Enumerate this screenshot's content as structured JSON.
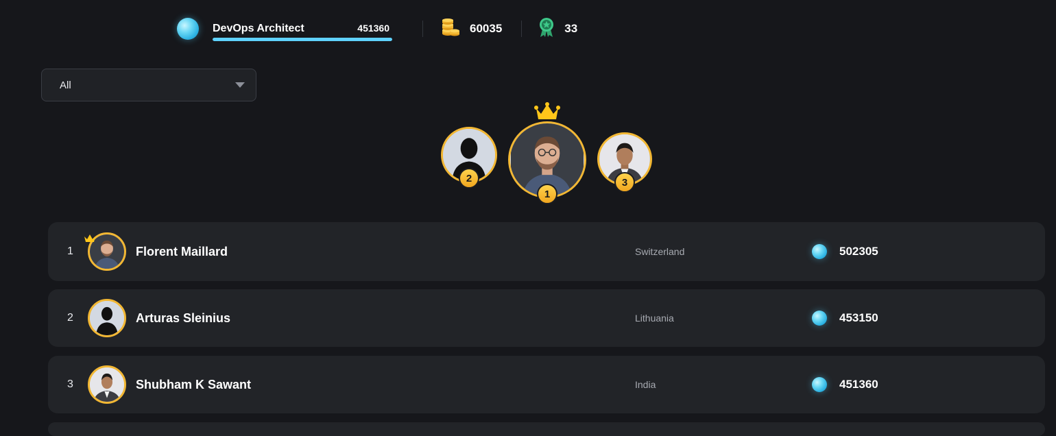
{
  "header": {
    "level_name": "DevOps Architect",
    "level_xp": "451360",
    "level_progress": 1.0,
    "coins": "60035",
    "badges": "33"
  },
  "filter": {
    "selected": "All"
  },
  "podium": [
    {
      "rank": "2",
      "avatar": "silhouette"
    },
    {
      "rank": "1",
      "avatar": "photo"
    },
    {
      "rank": "3",
      "avatar": "photo"
    }
  ],
  "leaderboard": [
    {
      "rank": "1",
      "name": "Florent Maillard",
      "country": "Switzerland",
      "score": "502305"
    },
    {
      "rank": "2",
      "name": "Arturas Sleinius",
      "country": "Lithuania",
      "score": "453150"
    },
    {
      "rank": "3",
      "name": "Shubham K Sawant",
      "country": "India",
      "score": "451360"
    }
  ],
  "icons": {
    "gem": "gem-icon",
    "coins": "coin-stack-icon",
    "badge": "award-ribbon-icon",
    "crown": "crown-icon",
    "dropdown": "chevron-down-icon"
  },
  "colors": {
    "accent_gold": "#f2b733",
    "accent_cyan": "#5fd2ff",
    "badge_green": "#3ec98a",
    "background": "#16171b",
    "row_background": "#222428"
  }
}
